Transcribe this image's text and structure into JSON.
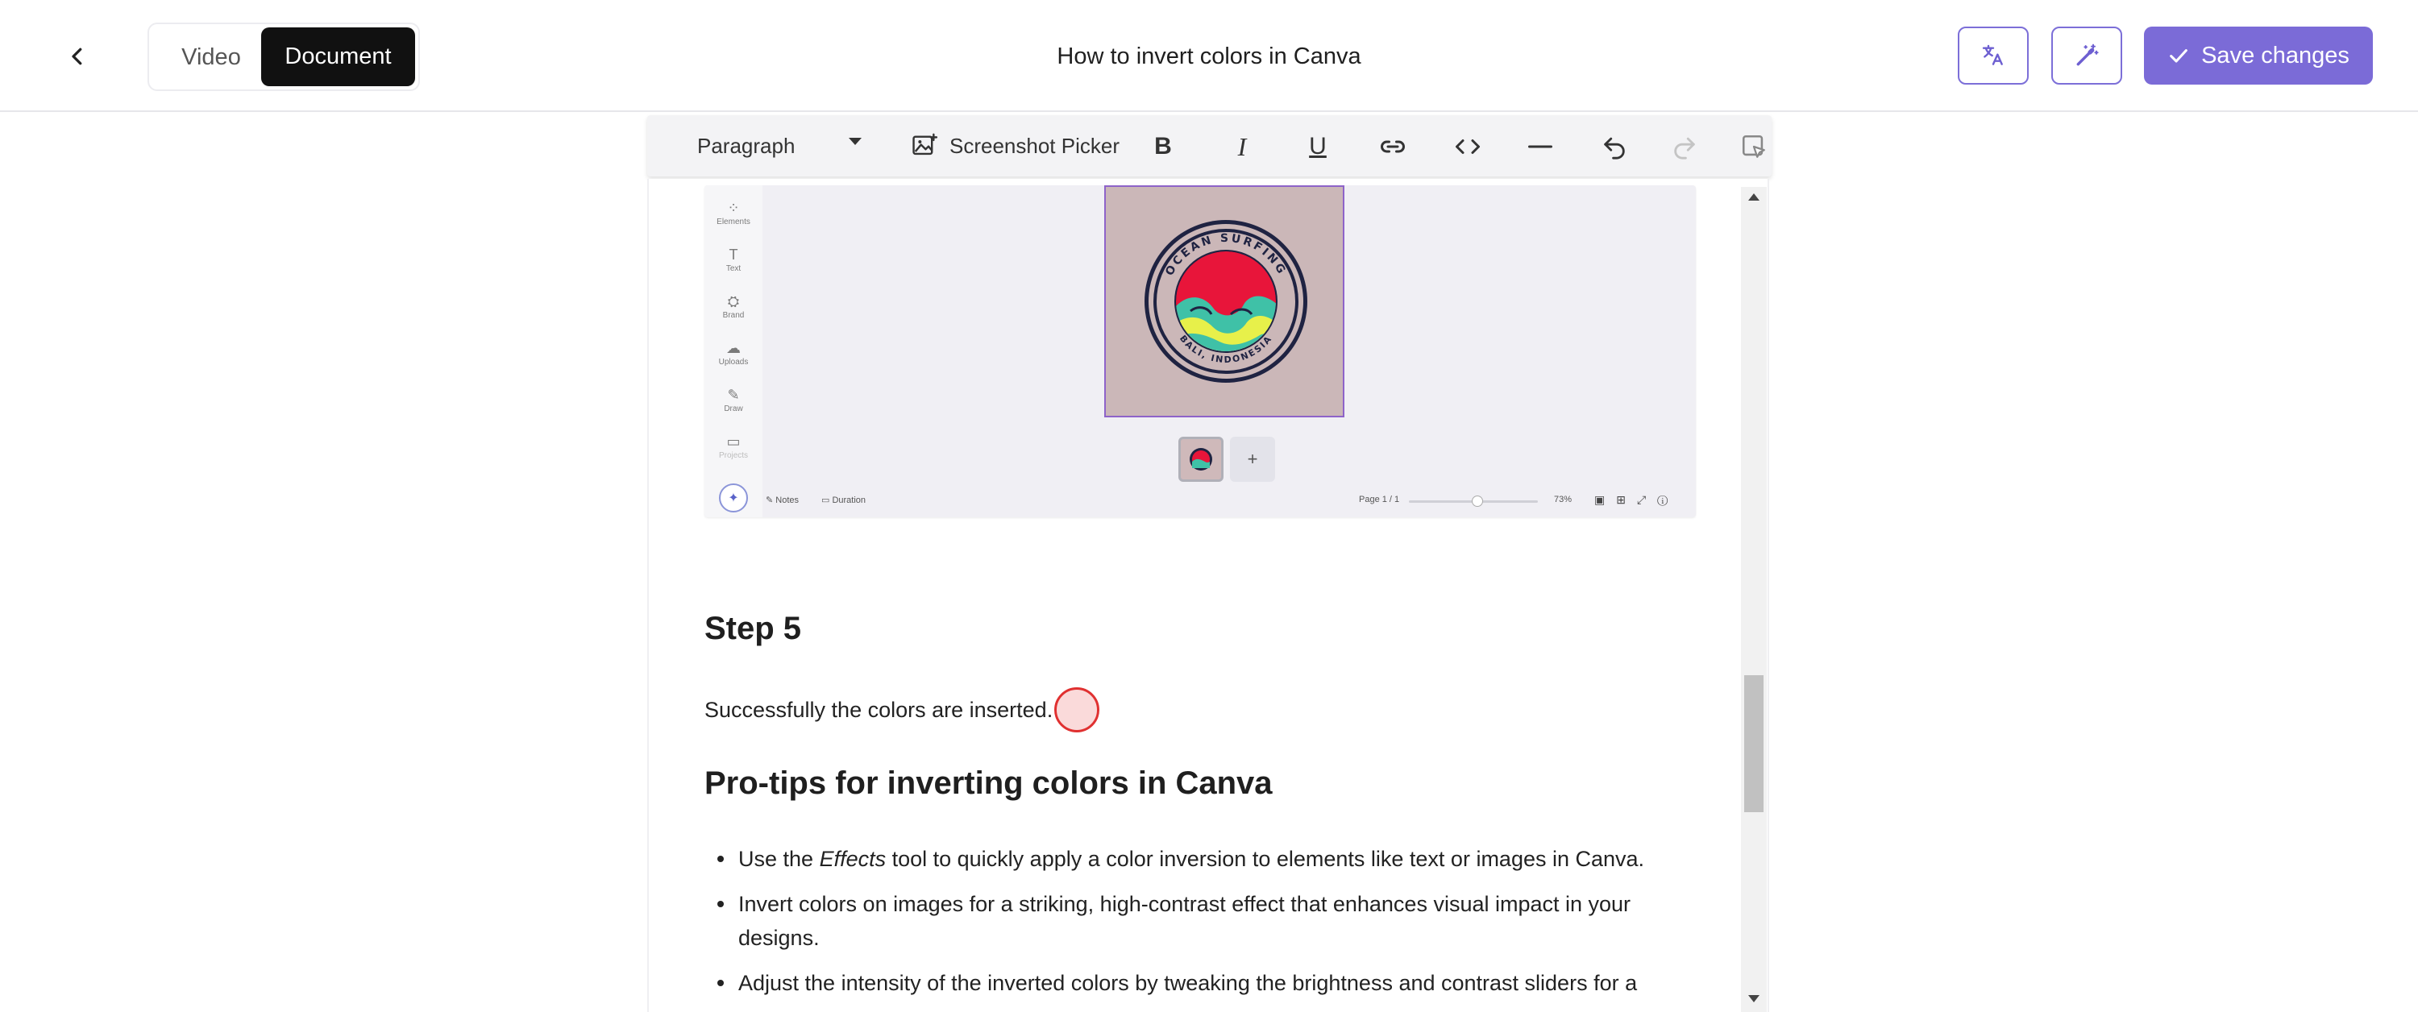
{
  "header": {
    "mode_tabs": {
      "video": "Video",
      "document": "Document"
    },
    "title": "How to invert colors in Canva",
    "save_label": "Save changes",
    "icons": [
      "back-arrow-icon",
      "translate-icon",
      "magic-wand-icon",
      "checkmark-icon"
    ]
  },
  "toolbar": {
    "paragraph_label": "Paragraph",
    "screenshot_picker_label": "Screenshot Picker",
    "icons": [
      "bold-icon",
      "italic-icon",
      "underline-icon",
      "link-icon",
      "code-icon",
      "horizontal-rule-icon",
      "undo-icon",
      "redo-icon",
      "edit-selection-icon"
    ]
  },
  "screenshot": {
    "sidebar_items": [
      "Elements",
      "Text",
      "Brand",
      "Uploads",
      "Draw",
      "Projects"
    ],
    "logo_top_text": "OCEAN SURFING",
    "logo_bottom_text": "BALI, INDONESIA",
    "footer": {
      "notes": "Notes",
      "duration": "Duration",
      "page": "Page 1 / 1",
      "zoom": "73%"
    },
    "add_page": "+"
  },
  "content": {
    "step_heading": "Step 5",
    "step_text": "Successfully the colors are inserted.",
    "pro_heading": "Pro-tips for inverting colors in Canva",
    "tips": [
      {
        "before": "Use the ",
        "em": "Effects",
        "after": " tool to quickly apply a color inversion to elements like text or images in Canva."
      },
      {
        "before": "Invert colors on images for a striking, high-contrast effect that enhances visual impact in your designs.",
        "em": "",
        "after": ""
      },
      {
        "before": "Adjust the intensity of the inverted colors by tweaking the brightness and contrast sliders for a",
        "em": "",
        "after": ""
      }
    ]
  },
  "colors": {
    "accent": "#7b6bd7",
    "active_tab": "#111111",
    "cursor_ring": "#e03131"
  }
}
